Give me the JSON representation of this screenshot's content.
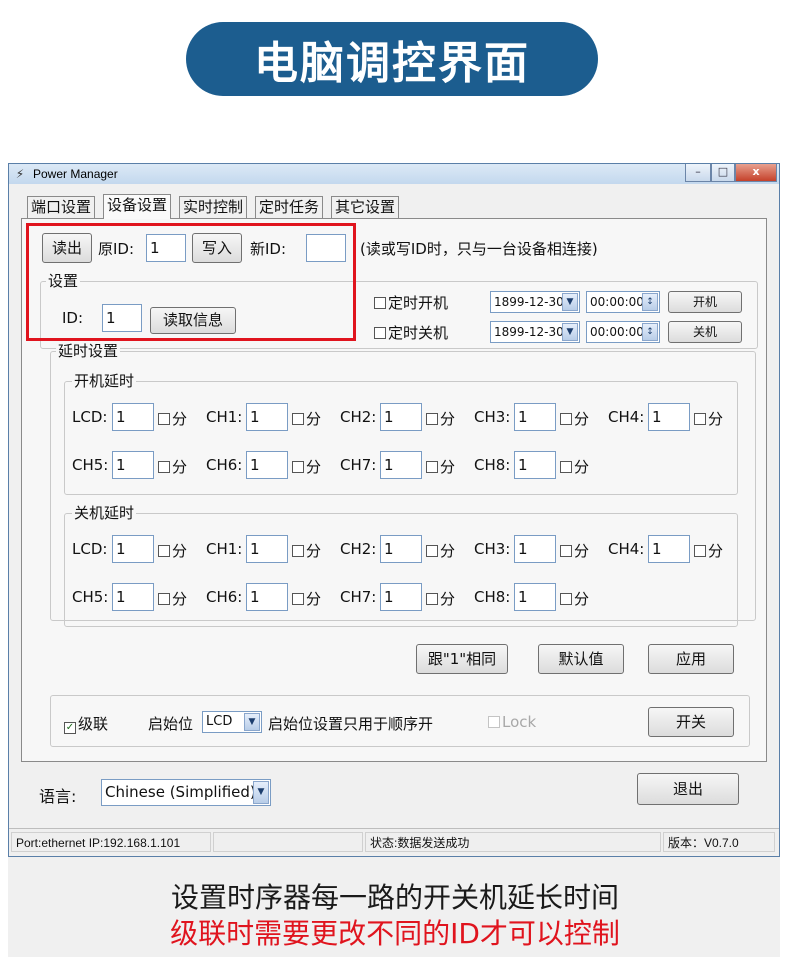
{
  "banner": {
    "title": "电脑调控界面"
  },
  "window": {
    "title": "Power Manager",
    "app_icon": "power-plug-icon",
    "controls": [
      "–",
      "□",
      "x"
    ]
  },
  "tabs": [
    {
      "label": "端口设置",
      "active": false
    },
    {
      "label": "设备设置",
      "active": true
    },
    {
      "label": "实时控制",
      "active": false
    },
    {
      "label": "定时任务",
      "active": false
    },
    {
      "label": "其它设置",
      "active": false
    }
  ],
  "id_row": {
    "read_btn": "读出",
    "orig_id_label": "原ID:",
    "orig_id_value": "1",
    "write_btn": "写入",
    "new_id_label": "新ID:",
    "new_id_value": "",
    "hint": "(读或写ID时，只与一台设备相连接)"
  },
  "settings_group": {
    "label": "设置",
    "id_label": "ID:",
    "id_value": "1",
    "read_info_btn": "读取信息"
  },
  "timer": {
    "on_label": "定时开机",
    "on_date": "1899-12-30",
    "on_time": "00:00:00",
    "on_btn": "开机",
    "off_label": "定时关机",
    "off_date": "1899-12-30",
    "off_time": "00:00:00",
    "off_btn": "关机"
  },
  "delay": {
    "label": "延时设置",
    "unit": "分",
    "on_group": {
      "label": "开机延时",
      "channels": [
        {
          "name": "LCD:",
          "value": "1"
        },
        {
          "name": "CH1:",
          "value": "1"
        },
        {
          "name": "CH2:",
          "value": "1"
        },
        {
          "name": "CH3:",
          "value": "1"
        },
        {
          "name": "CH4:",
          "value": "1"
        },
        {
          "name": "CH5:",
          "value": "1"
        },
        {
          "name": "CH6:",
          "value": "1"
        },
        {
          "name": "CH7:",
          "value": "1"
        },
        {
          "name": "CH8:",
          "value": "1"
        }
      ]
    },
    "off_group": {
      "label": "关机延时",
      "channels": [
        {
          "name": "LCD:",
          "value": "1"
        },
        {
          "name": "CH1:",
          "value": "1"
        },
        {
          "name": "CH2:",
          "value": "1"
        },
        {
          "name": "CH3:",
          "value": "1"
        },
        {
          "name": "CH4:",
          "value": "1"
        },
        {
          "name": "CH5:",
          "value": "1"
        },
        {
          "name": "CH6:",
          "value": "1"
        },
        {
          "name": "CH7:",
          "value": "1"
        },
        {
          "name": "CH8:",
          "value": "1"
        }
      ]
    },
    "same_btn": "跟\"1\"相同",
    "default_btn": "默认值",
    "apply_btn": "应用"
  },
  "cascade": {
    "checkbox_label": "级联",
    "checked": true,
    "start_label": "启始位",
    "start_value": "LCD",
    "start_hint": "启始位设置只用于顺序开",
    "lock_label": "Lock",
    "switch_btn": "开关"
  },
  "language": {
    "label": "语言:",
    "value": "Chinese (Simplified)"
  },
  "exit_btn": "退出",
  "status_bar": {
    "port": "Port:ethernet IP:192.168.1.101",
    "state": "状态:数据发送成功",
    "version": "版本：V0.7.0"
  },
  "captions": {
    "line1": "设置时序器每一路的开关机延长时间",
    "line2": "级联时需要更改不同的ID才可以控制"
  },
  "colors": {
    "banner": "#1c5d8f",
    "highlight": "#e0141e",
    "caption2": "#e0141e"
  }
}
